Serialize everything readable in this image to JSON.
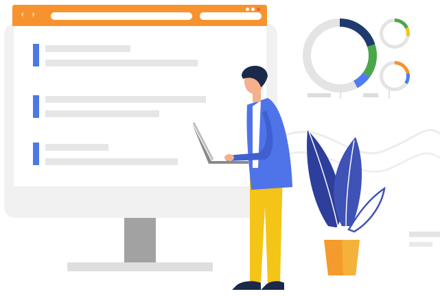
{
  "browser": {
    "back_icon": "chevron-left-icon",
    "forward_icon": "chevron-right-icon",
    "back_glyph": "‹",
    "forward_glyph": "›"
  },
  "palette": {
    "bar": "#f7932f",
    "accent": "#4c78e6",
    "jacket": "#4f73e8",
    "pants": "#f4c417",
    "hair": "#1b2a4a",
    "skin": "#f5b08c",
    "plant_dark": "#2d3e9b",
    "plant_mid": "#3f52b5",
    "pot": "#f59a2c",
    "donut_navy": "#1f3a6e",
    "donut_green": "#49a74a",
    "donut_blue": "#4f7cf0",
    "donut_orange": "#f7932f",
    "donut_yellow": "#f4c417",
    "ring_gray": "#e4e4e4"
  },
  "donuts": [
    {
      "segments": [
        {
          "color": "donut_navy",
          "fraction": 0.2
        },
        {
          "color": "donut_green",
          "fraction": 0.15
        },
        {
          "color": "donut_blue",
          "fraction": 0.07
        }
      ]
    },
    {
      "segments": [
        {
          "color": "donut_green",
          "fraction": 0.18
        },
        {
          "color": "donut_yellow",
          "fraction": 0.1
        }
      ]
    },
    {
      "segments": [
        {
          "color": "donut_orange",
          "fraction": 0.22
        },
        {
          "color": "donut_blue",
          "fraction": 0.12
        }
      ]
    }
  ]
}
